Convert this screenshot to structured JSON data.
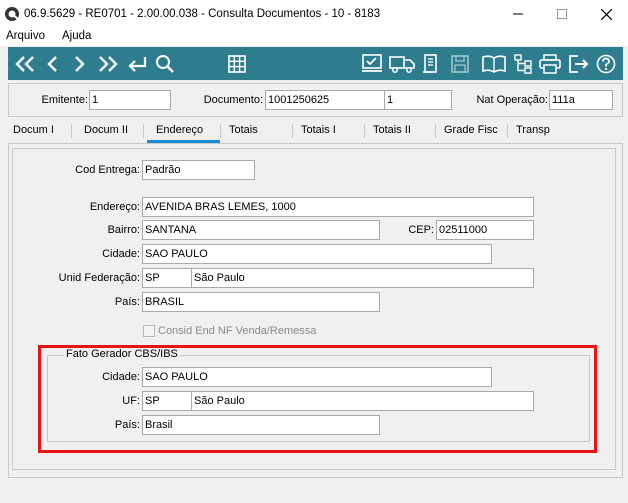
{
  "window": {
    "title": "06.9.5629 - RE0701 - 2.00.00.038 - Consulta Documentos - 10 - 8183"
  },
  "menu": {
    "items": [
      "Arquivo",
      "Ajuda"
    ]
  },
  "toolbar": {
    "background": "#2e7d8f",
    "icons": [
      "first-icon",
      "previous-icon",
      "next-icon",
      "last-icon",
      "return-icon",
      "search-icon",
      "grid-icon",
      "checklist-icon",
      "truck-icon",
      "scroll-icon",
      "save-icon",
      "book-icon",
      "tree-icon",
      "print-icon",
      "exit-icon",
      "help-icon"
    ]
  },
  "header": {
    "emitente_label": "Emitente:",
    "emitente_value": "1",
    "documento_label": "Documento:",
    "documento_value": "1001250625",
    "serie_value": "1",
    "nat_operacao_label": "Nat Operação:",
    "nat_operacao_value": "111a"
  },
  "tabs": [
    {
      "label": "Docum I"
    },
    {
      "label": "Docum II"
    },
    {
      "label": "Endereço"
    },
    {
      "label": "Totais"
    },
    {
      "label": "Totais I"
    },
    {
      "label": "Totais II"
    },
    {
      "label": "Grade Fisc"
    },
    {
      "label": "Transp"
    }
  ],
  "active_tab": "Endereço",
  "address": {
    "cod_entrega_label": "Cod Entrega:",
    "cod_entrega_value": "Padrão",
    "endereco_label": "Endereço:",
    "endereco_value": "AVENIDA BRAS LEMES, 1000",
    "bairro_label": "Bairro:",
    "bairro_value": "SANTANA",
    "cep_label": "CEP:",
    "cep_value": "02511000",
    "cidade_label": "Cidade:",
    "cidade_value": "SAO PAULO",
    "uf_label": "Unid Federação:",
    "uf_code": "SP",
    "uf_name": "São Paulo",
    "pais_label": "País:",
    "pais_value": "BRASIL",
    "consid_label": "Consid End NF Venda/Remessa"
  },
  "fato_gerador": {
    "title": "Fato Gerador CBS/IBS",
    "cidade_label": "Cidade:",
    "cidade_value": "SAO PAULO",
    "uf_label": "UF:",
    "uf_code": "SP",
    "uf_name": "São Paulo",
    "pais_label": "País:",
    "pais_value": "Brasil"
  },
  "colors": {
    "highlight": "#e81313",
    "tab_underline": "#1a8ad4"
  }
}
